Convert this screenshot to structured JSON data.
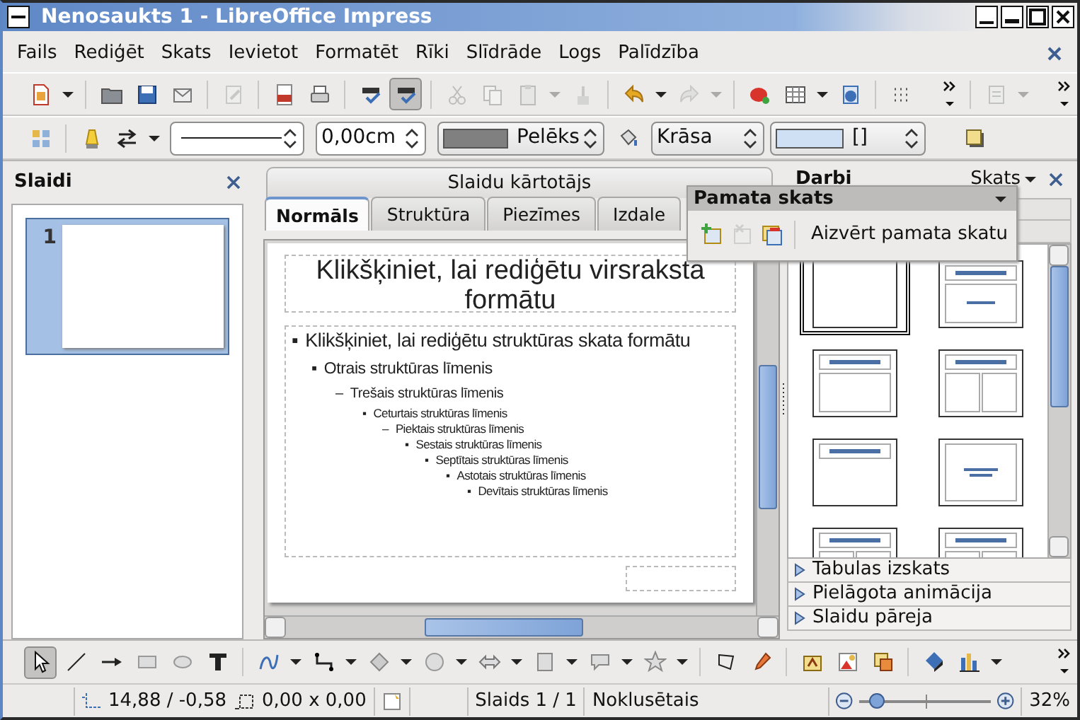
{
  "window": {
    "title": "Nenosaukts 1 - LibreOffice Impress"
  },
  "menu": [
    "Fails",
    "Rediģēt",
    "Skats",
    "Ievietot",
    "Formatēt",
    "Rīki",
    "Slīdrāde",
    "Logs",
    "Palīdzība"
  ],
  "standard_toolbar": [
    {
      "disabled": false,
      "pressed": false
    },
    {
      "disabled": false,
      "pressed": false
    },
    {
      "disabled": false,
      "pressed": false
    },
    {
      "disabled": false,
      "pressed": false
    },
    {
      "disabled": true,
      "pressed": false
    },
    {
      "disabled": false,
      "pressed": false
    },
    {
      "disabled": false,
      "pressed": false
    },
    {
      "disabled": false,
      "pressed": false
    },
    {
      "disabled": false,
      "pressed": true
    },
    {
      "disabled": true,
      "pressed": false
    },
    {
      "disabled": true,
      "pressed": false
    },
    {
      "disabled": true,
      "pressed": false
    },
    {
      "disabled": true,
      "pressed": false
    },
    {
      "disabled": false,
      "pressed": false
    },
    {
      "disabled": true,
      "pressed": false
    },
    {
      "disabled": false,
      "pressed": false
    },
    {
      "disabled": false,
      "pressed": false
    },
    {
      "disabled": false,
      "pressed": false
    },
    {
      "disabled": false,
      "pressed": false
    },
    {
      "disabled": true,
      "pressed": false
    }
  ],
  "line_toolbar": {
    "buttons": [
      {
        "disabled": false
      },
      {
        "disabled": false
      },
      {
        "disabled": false
      },
      {
        "disabled": false
      },
      {
        "disabled": false
      }
    ],
    "line_width": "0,00cm",
    "line_color": "Pelēks",
    "area_style": "Krāsa",
    "area_fill": "[]"
  },
  "slides_panel": {
    "title": "Slaidi",
    "slides": [
      {
        "number": "1",
        "selected": true
      }
    ]
  },
  "view": {
    "sorter_label": "Slaidu kārtotājs",
    "tabs": [
      {
        "label": "Normāls",
        "selected": true
      },
      {
        "label": "Struktūra",
        "selected": false
      },
      {
        "label": "Piezīmes",
        "selected": false
      },
      {
        "label": "Izdale",
        "selected": false
      }
    ],
    "slide": {
      "title": "Klikšķiniet, lai rediģētu virsraksta formātu",
      "outline": [
        {
          "bullet": "▪",
          "text": "Klikšķiniet, lai rediģētu struktūras skata formātu",
          "children": [
            {
              "bullet": "▪",
              "text": "Otrais struktūras līmenis",
              "children": [
                {
                  "bullet": "–",
                  "text": "Trešais struktūras līmenis",
                  "children": [
                    {
                      "bullet": "▪",
                      "text": "Ceturtais struktūras līmenis",
                      "children": [
                        {
                          "bullet": "–",
                          "text": "Piektais struktūras līmenis",
                          "children": [
                            {
                              "bullet": "▪",
                              "text": "Sestais struktūras līmenis",
                              "children": [
                                {
                                  "bullet": "▪",
                                  "text": "Septītais struktūras līmenis",
                                  "children": [
                                    {
                                      "bullet": "▪",
                                      "text": "Astotais struktūras līmenis",
                                      "children": [
                                        {
                                          "bullet": "▪",
                                          "text": "Devītais struktūras līmenis"
                                        }
                                      ]
                                    }
                                  ]
                                }
                              ]
                            }
                          ]
                        }
                      ]
                    }
                  ]
                }
              ]
            }
          ]
        }
      ]
    }
  },
  "tasks_panel": {
    "title": "Darbi",
    "view_menu": "Skats",
    "layouts": [
      {
        "kind": "blank",
        "selected": true
      },
      {
        "kind": "title-slide",
        "selected": false
      },
      {
        "kind": "title-content",
        "selected": false
      },
      {
        "kind": "title-2col",
        "selected": false
      },
      {
        "kind": "title-only",
        "selected": false
      },
      {
        "kind": "centered-text",
        "selected": false
      },
      {
        "kind": "title-2col",
        "selected": false
      },
      {
        "kind": "title-2col",
        "selected": false
      }
    ],
    "sections": [
      {
        "label": "Tabulas izskats",
        "expanded": false
      },
      {
        "label": "Pielāgota animācija",
        "expanded": false
      },
      {
        "label": "Slaidu pāreja",
        "expanded": false
      }
    ]
  },
  "master_toolbar": {
    "title": "Pamata skats",
    "buttons": [
      {
        "disabled": false
      },
      {
        "disabled": true
      },
      {
        "disabled": false
      }
    ],
    "close_label": "Aizvērt pamata skatu"
  },
  "drawing_toolbar": [
    {
      "pressed": true
    },
    {
      "pressed": false
    },
    {
      "pressed": false
    },
    {
      "pressed": false
    },
    {
      "pressed": false
    },
    {
      "pressed": false
    },
    {
      "pressed": false
    },
    {
      "pressed": false
    },
    {
      "pressed": false
    },
    {
      "pressed": false
    },
    {
      "pressed": false
    },
    {
      "pressed": false
    },
    {
      "pressed": false
    },
    {
      "pressed": false
    },
    {
      "pressed": false
    },
    {
      "pressed": false
    },
    {
      "pressed": false
    },
    {
      "pressed": false
    },
    {
      "pressed": false
    },
    {
      "pressed": false
    },
    {
      "pressed": false
    }
  ],
  "status_bar": {
    "position": "14,88 / -0,58",
    "size": "0,00 x 0,00",
    "slide": "Slaids 1 / 1",
    "layout": "Noklusētais",
    "zoom": {
      "level": 0.13
    },
    "zoom_percent": "32%"
  }
}
